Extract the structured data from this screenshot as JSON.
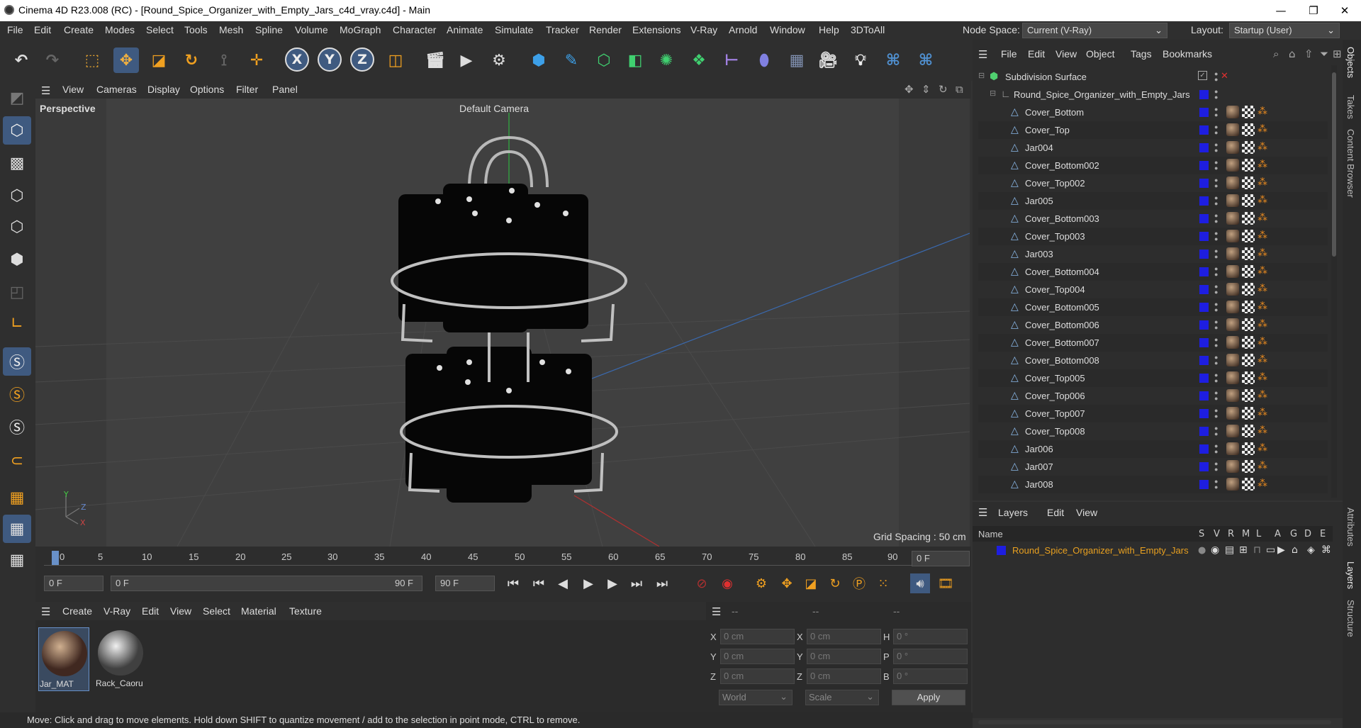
{
  "window": {
    "title": "Cinema 4D R23.008 (RC) - [Round_Spice_Organizer_with_Empty_Jars_c4d_vray.c4d] - Main",
    "minimize": "—",
    "maximize": "❐",
    "close": "✕"
  },
  "menubar": {
    "items": [
      "File",
      "Edit",
      "Create",
      "Modes",
      "Select",
      "Tools",
      "Mesh",
      "Spline",
      "Volume",
      "MoGraph",
      "Character",
      "Animate",
      "Simulate",
      "Tracker",
      "Render",
      "Extensions",
      "V-Ray",
      "Arnold",
      "Window",
      "Help",
      "3DToAll"
    ],
    "node_space_label": "Node Space:",
    "node_space_value": "Current (V-Ray)",
    "layout_label": "Layout:",
    "layout_value": "Startup (User)"
  },
  "toolbar": {
    "x_label": "X",
    "y_label": "Y",
    "z_label": "Z"
  },
  "viewport_menu": {
    "items": [
      "View",
      "Cameras",
      "Display",
      "Options",
      "Filter",
      "Panel"
    ]
  },
  "viewport": {
    "name": "Perspective",
    "camera": "Default Camera",
    "grid_spacing": "Grid Spacing : 50 cm",
    "axis_y": "Y",
    "axis_z": "Z",
    "axis_x": "X"
  },
  "timeline": {
    "ticks": [
      "0",
      "5",
      "10",
      "15",
      "20",
      "25",
      "30",
      "35",
      "40",
      "45",
      "50",
      "55",
      "60",
      "65",
      "70",
      "75",
      "80",
      "85",
      "90"
    ],
    "current_frame": "0 F",
    "start_frame": "0 F",
    "range_start": "0 F",
    "range_end": "90 F",
    "end_frame": "90 F"
  },
  "material_menu": {
    "items": [
      "Create",
      "V-Ray",
      "Edit",
      "View",
      "Select",
      "Material",
      "Texture"
    ]
  },
  "materials": [
    {
      "name": "Jar_MAT"
    },
    {
      "name": "Rack_Caoru"
    }
  ],
  "coordinates": {
    "headers": [
      "--",
      "--",
      "--"
    ],
    "rows": [
      {
        "a": "X",
        "pos": "0 cm",
        "b": "X",
        "size": "0 cm",
        "c": "H",
        "rot": "0 °"
      },
      {
        "a": "Y",
        "pos": "0 cm",
        "b": "Y",
        "size": "0 cm",
        "c": "P",
        "rot": "0 °"
      },
      {
        "a": "Z",
        "pos": "0 cm",
        "b": "Z",
        "size": "0 cm",
        "c": "B",
        "rot": "0 °"
      }
    ],
    "mode": "World",
    "transform": "Scale",
    "apply": "Apply"
  },
  "status": "Move: Click and drag to move elements. Hold down SHIFT to quantize movement / add to the selection in point mode, CTRL to remove.",
  "object_manager": {
    "menu": [
      "File",
      "Edit",
      "View",
      "Object",
      "Tags",
      "Bookmarks"
    ],
    "root": "Subdivision Surface",
    "group": "Round_Spice_Organizer_with_Empty_Jars",
    "objects": [
      "Cover_Bottom",
      "Cover_Top",
      "Jar004",
      "Cover_Bottom002",
      "Cover_Top002",
      "Jar005",
      "Cover_Bottom003",
      "Cover_Top003",
      "Jar003",
      "Cover_Bottom004",
      "Cover_Top004",
      "Cover_Bottom005",
      "Cover_Bottom006",
      "Cover_Bottom007",
      "Cover_Bottom008",
      "Cover_Top005",
      "Cover_Top006",
      "Cover_Top007",
      "Cover_Top008",
      "Jar006",
      "Jar007",
      "Jar008"
    ]
  },
  "layer_manager": {
    "menu": [
      "Layers",
      "Edit",
      "View"
    ],
    "columns": {
      "name": "Name",
      "flags": [
        "S",
        "V",
        "R",
        "M",
        "L",
        "A",
        "G",
        "D",
        "E"
      ]
    },
    "layers": [
      {
        "name": "Round_Spice_Organizer_with_Empty_Jars"
      }
    ]
  },
  "right_tabs": [
    "Objects",
    "Takes",
    "Content Browser",
    "Attributes",
    "Layers",
    "Structure"
  ],
  "colors": {
    "accent": "#3f5a80",
    "layer_color": "#1e1ee0",
    "layer_text": "#e8a020"
  }
}
